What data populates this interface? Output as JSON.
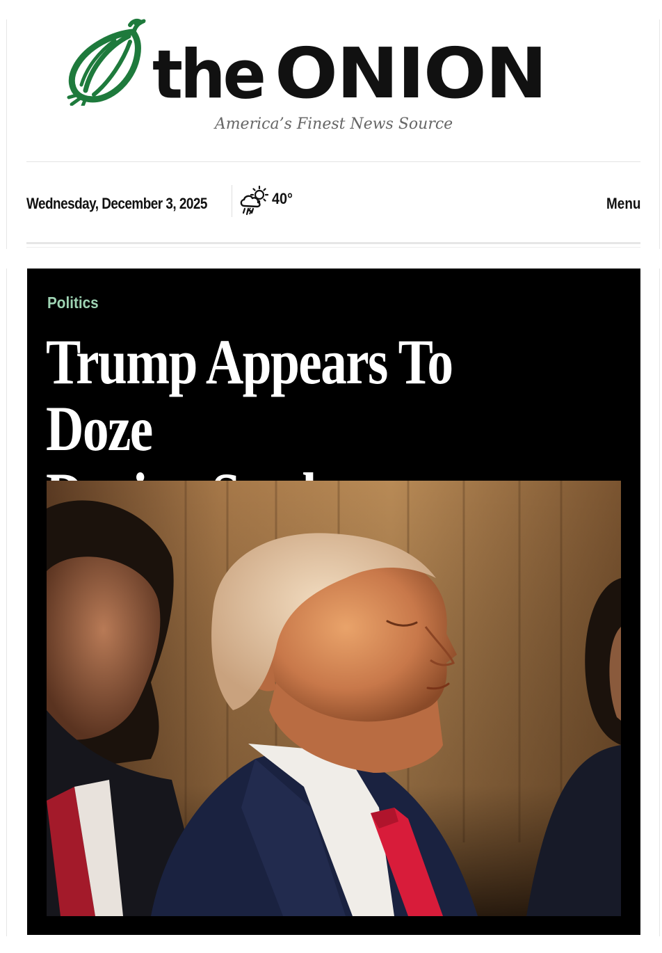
{
  "masthead": {
    "logo_part1": "the",
    "logo_part2": "ONION",
    "tagline": "America’s Finest News Source",
    "brand_green": "#1e7a3c"
  },
  "info_bar": {
    "date": "Wednesday, December 3, 2025",
    "weather_icon": "partly-cloudy-storm-icon",
    "temperature": "40°",
    "menu_label": "Menu"
  },
  "article": {
    "category": "Politics",
    "category_color": "#9ed3b3",
    "headline_line1": "Trump Appears To Doze",
    "headline_line2": "During Stroke",
    "photo_subject": "photo of seated men in suits, central figure with eyes closed"
  }
}
